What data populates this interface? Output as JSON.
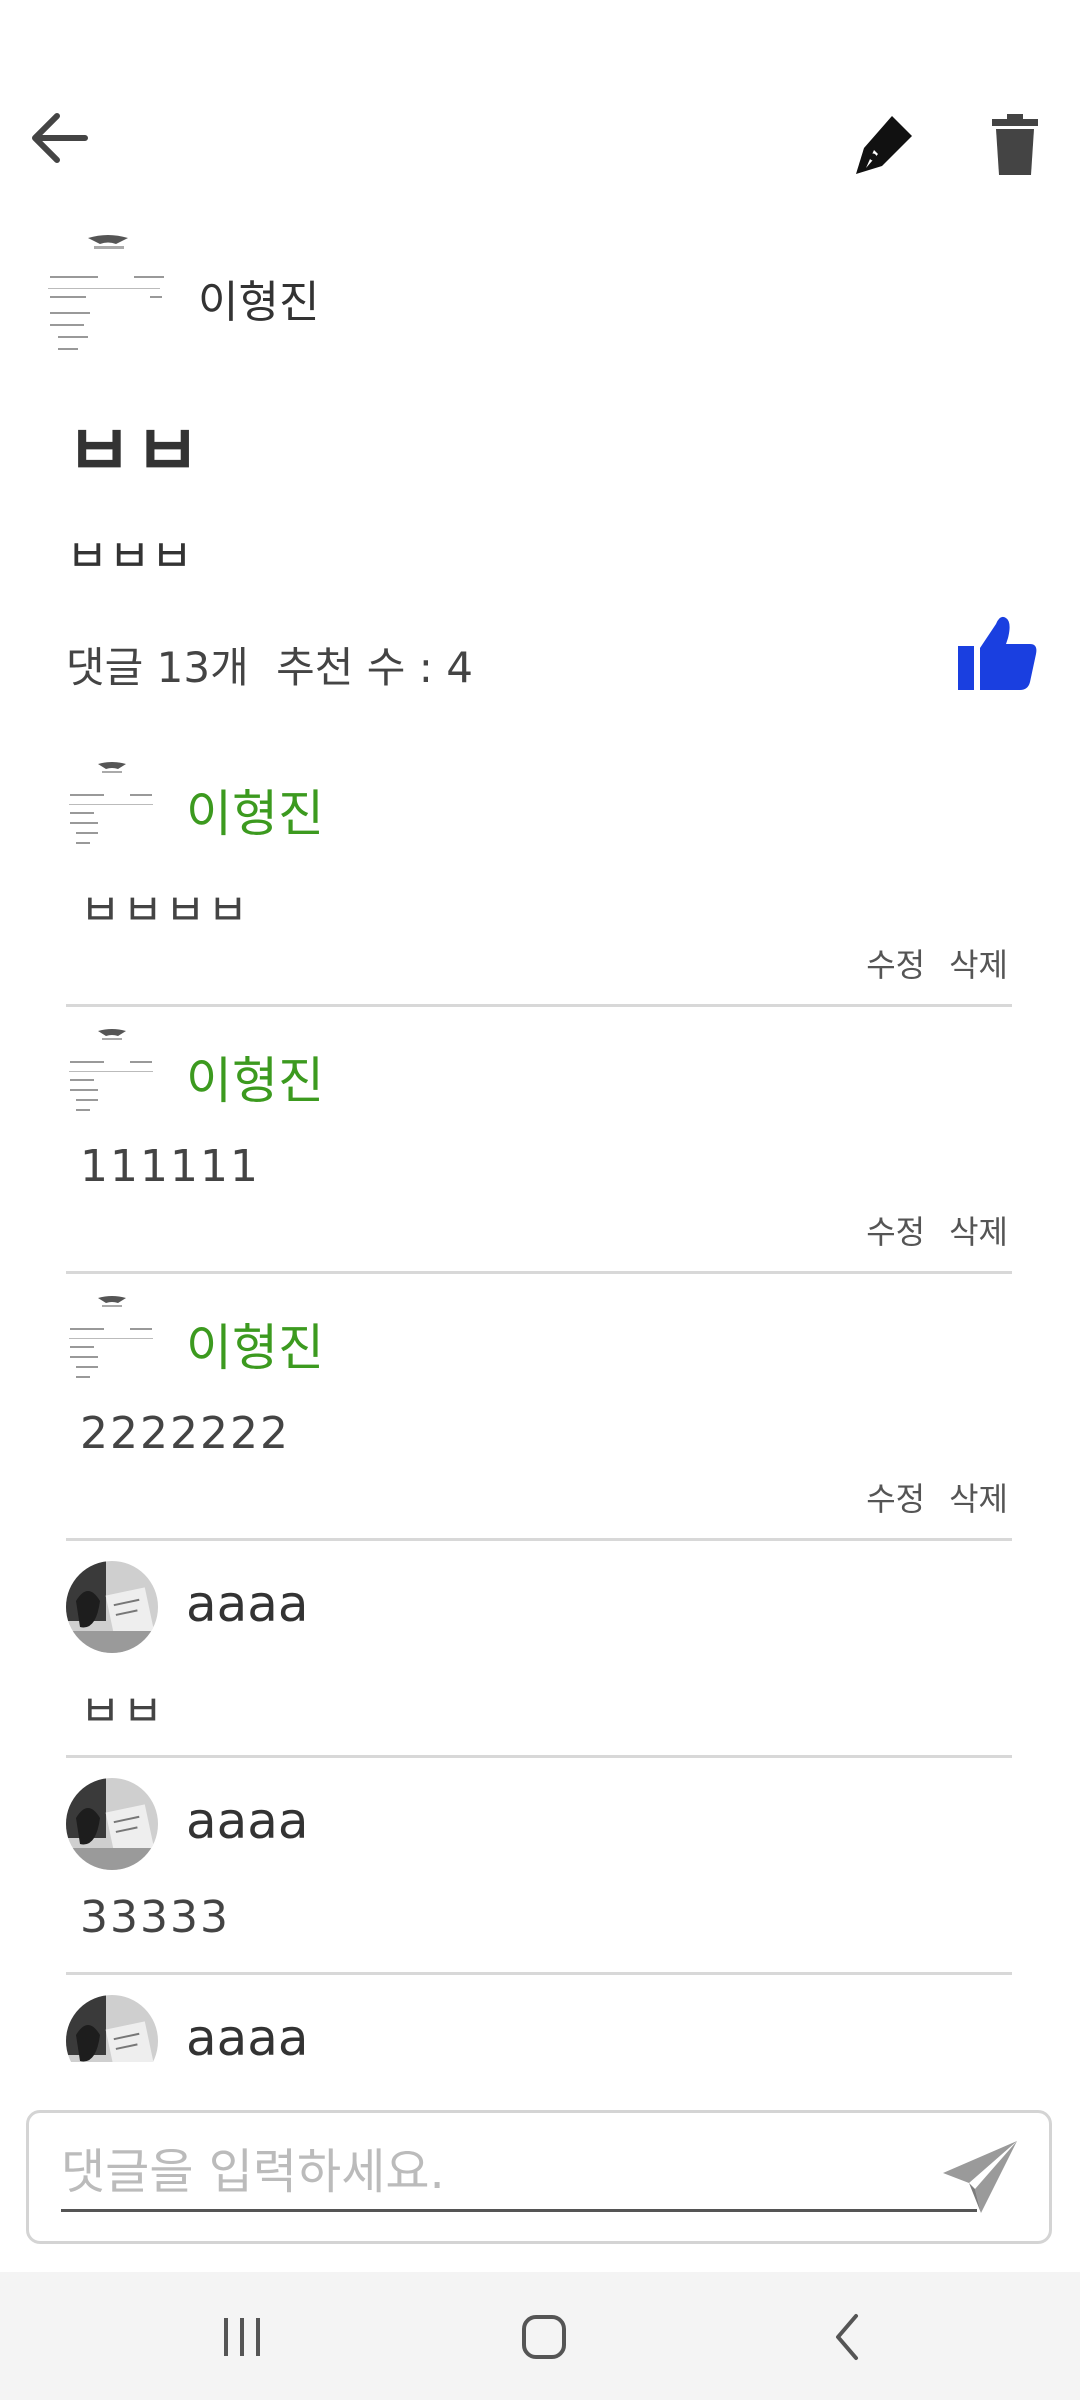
{
  "header": {
    "back_icon": "arrow-left-icon",
    "edit_icon": "pen-icon",
    "delete_icon": "trash-icon"
  },
  "post": {
    "author": "이형진",
    "title": "ㅂㅂ",
    "body": "ㅂㅂㅂ",
    "comment_count_label": "댓글 13개",
    "recommend_label": "추천 수 : 4",
    "like_icon": "thumbs-up-icon"
  },
  "comments": [
    {
      "author": "이형진",
      "text": "ㅂㅂㅂㅂ",
      "edit_label": "수정",
      "delete_label": "삭제"
    },
    {
      "author": "이형진",
      "text": "111111",
      "edit_label": "수정",
      "delete_label": "삭제"
    },
    {
      "author": "이형진",
      "text": "2222222",
      "edit_label": "수정",
      "delete_label": "삭제"
    },
    {
      "author": "aaaa",
      "text": "ㅂㅂ"
    },
    {
      "author": "aaaa",
      "text": "33333"
    },
    {
      "author": "aaaa",
      "text": ""
    }
  ],
  "comment_input": {
    "placeholder": "댓글을 입력하세요.",
    "value": "",
    "send_icon": "send-icon"
  },
  "navbar": {
    "recent_icon": "recent-apps-icon",
    "home_icon": "home-icon",
    "back_icon": "back-chevron-icon"
  },
  "colors": {
    "accent_like": "#1a3fe0",
    "author_green": "#3c9a1f"
  }
}
